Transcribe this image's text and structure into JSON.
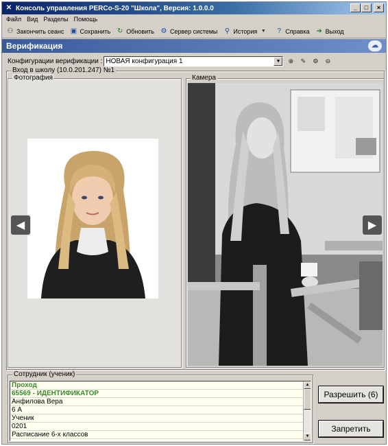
{
  "window": {
    "title": "Консоль управления PERCo-S-20 \"Школа\", Версия: 1.0.0.0",
    "controls": [
      "_",
      "□",
      "×"
    ]
  },
  "menu": [
    "Файл",
    "Вид",
    "Разделы",
    "Помощь"
  ],
  "toolbar": [
    {
      "icon": "end-session-icon",
      "label": "Закончить сеанс"
    },
    {
      "icon": "save-icon",
      "label": "Сохранить"
    },
    {
      "icon": "refresh-icon",
      "label": "Обновить"
    },
    {
      "icon": "server-icon",
      "label": "Сервер системы"
    },
    {
      "icon": "history-icon",
      "label": "История"
    },
    {
      "icon": "help-icon",
      "label": "Справка"
    },
    {
      "icon": "exit-icon",
      "label": "Выход"
    }
  ],
  "header": {
    "title": "Верификация"
  },
  "config": {
    "label": "Конфигурации верификации :",
    "selected": "НОВАЯ конфигурация 1"
  },
  "entry_point": {
    "label": "Вход в школу (10.0.201.247) №1"
  },
  "photo": {
    "label": "Фотография"
  },
  "camera": {
    "label": "Камера"
  },
  "employee": {
    "label": "Сотрудник (ученик)",
    "rows": [
      "Проход",
      "65569 - ИДЕНТИФИКАТОР",
      "Анфилова Вера",
      "6 А",
      "Ученик",
      "0201",
      "Расписание 6-х классов"
    ]
  },
  "actions": {
    "allow": "Разрешить (6)",
    "deny": "Запретить"
  },
  "colors": {
    "header": "#3b5a9a",
    "highlight_text": "#3a8a2a",
    "list_background": "#fffff0"
  }
}
